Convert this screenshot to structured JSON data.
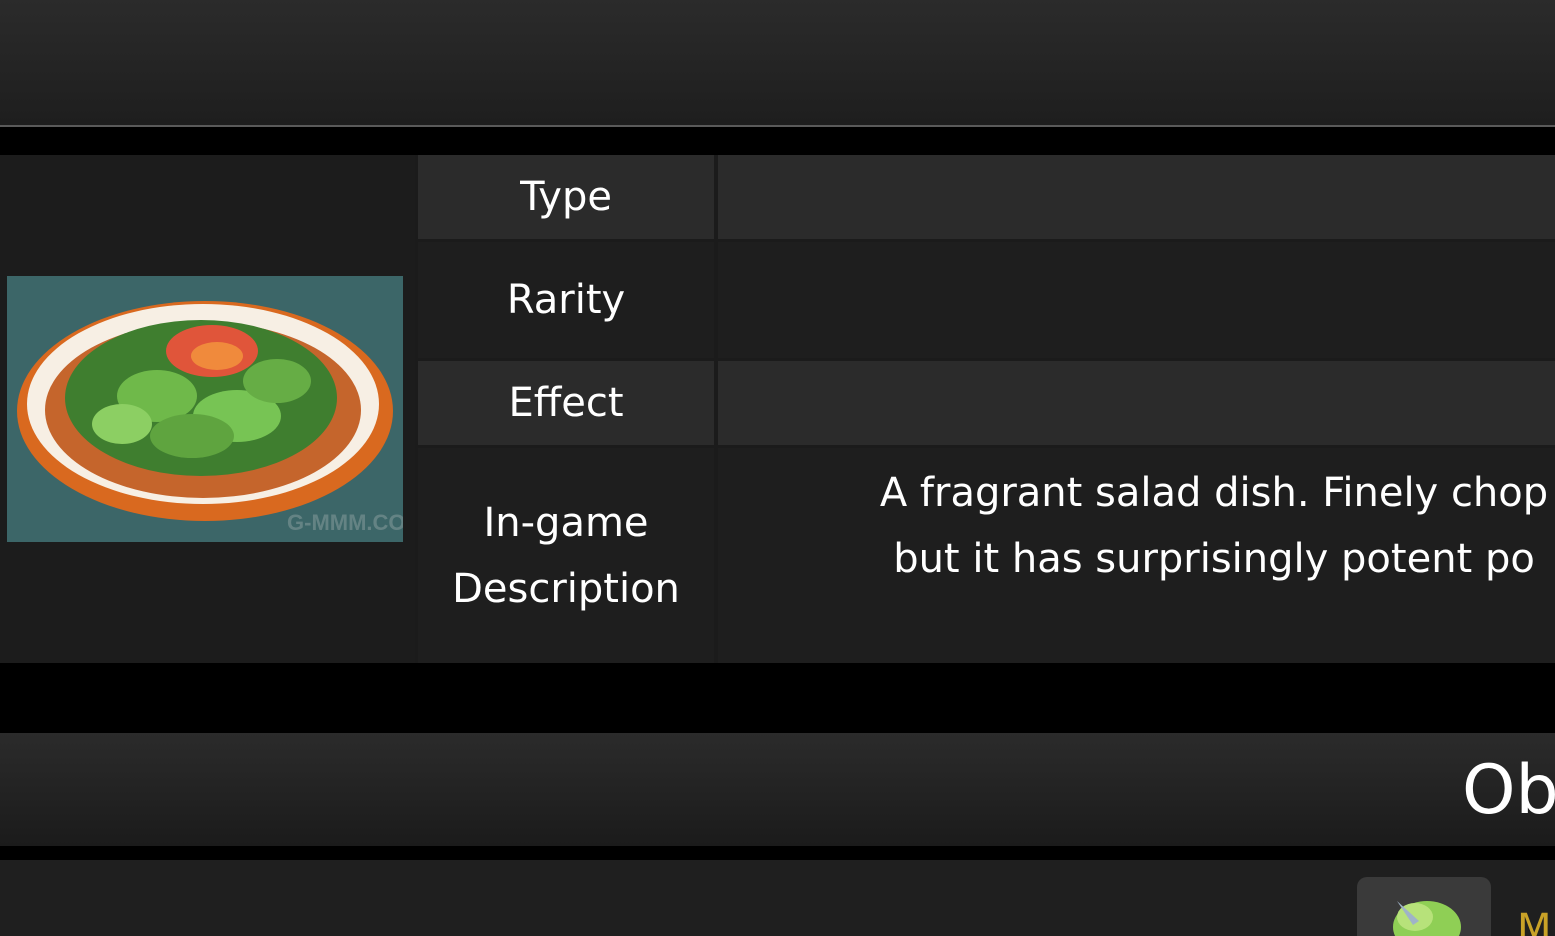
{
  "info_table": {
    "image_alt": "Salad dish image",
    "rows": [
      {
        "label": "Type",
        "value": ""
      },
      {
        "label": "Rarity",
        "value": ""
      },
      {
        "label": "Effect",
        "value": ""
      },
      {
        "label": "In-game Description",
        "value": "A fragrant salad dish. Finely chop\nbut it has surprisingly potent po"
      }
    ]
  },
  "section": {
    "title": "Ob"
  },
  "list": {
    "item_label": "M",
    "item_color": "#c9a227"
  }
}
